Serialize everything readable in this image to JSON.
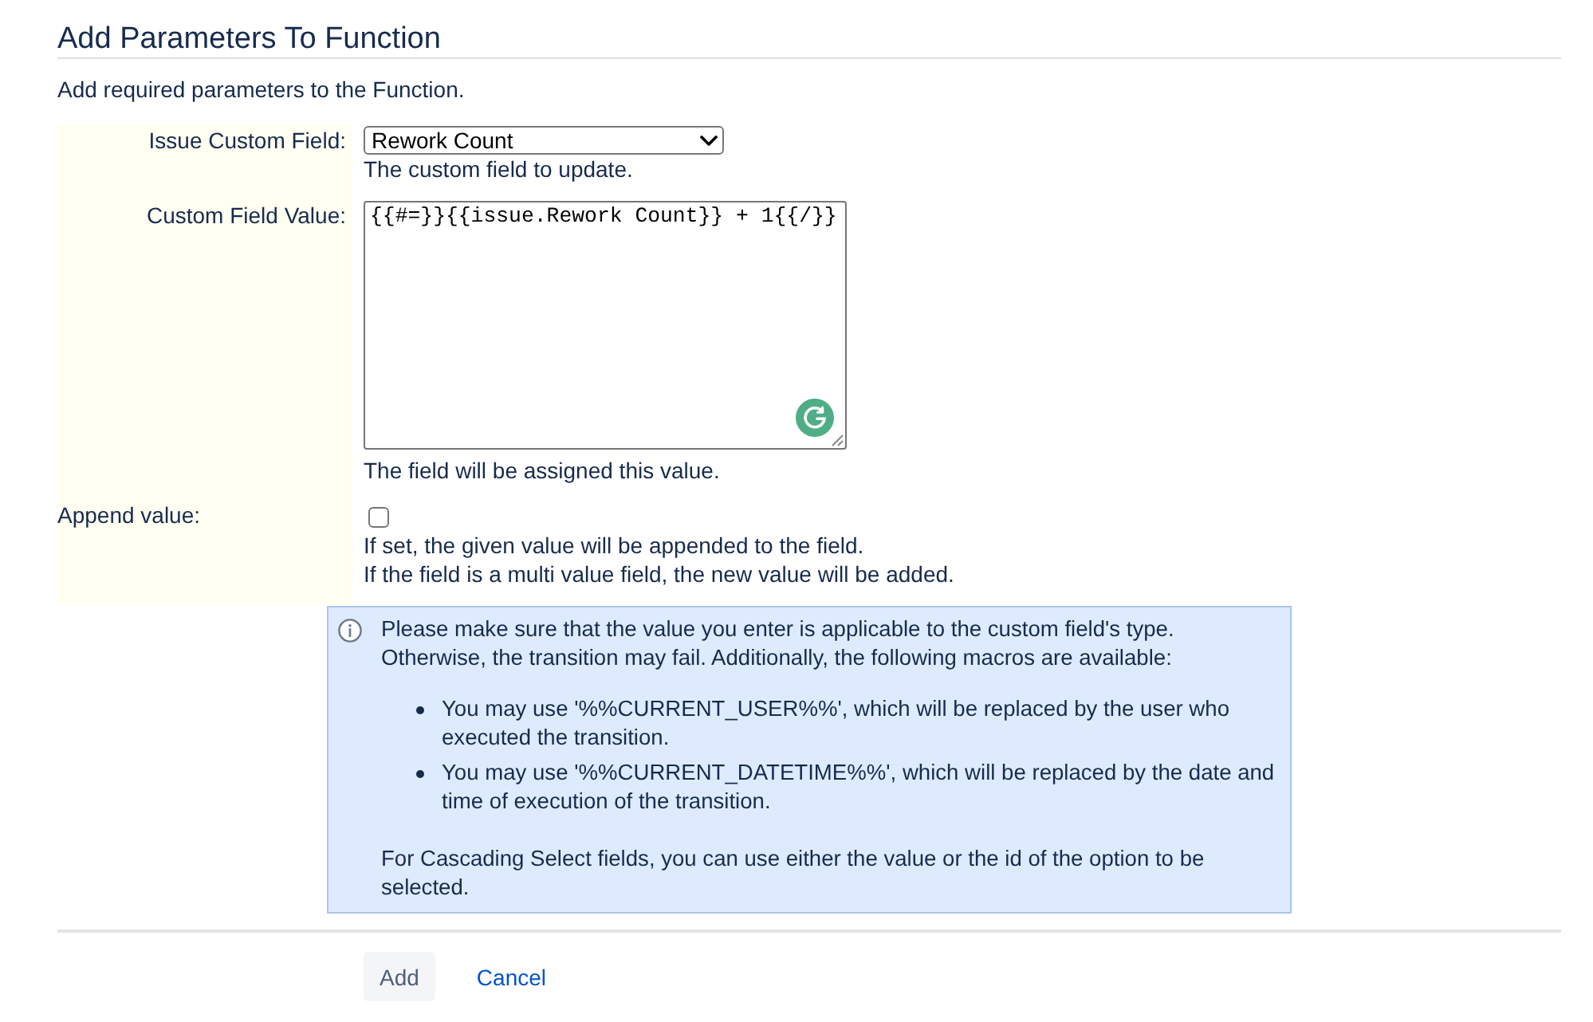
{
  "title": "Add Parameters To Function",
  "description": "Add required parameters to the Function.",
  "fields": [
    {
      "kind": "select",
      "label": "Issue Custom Field:",
      "value": "Rework Count",
      "help": [
        "The custom field to update."
      ]
    },
    {
      "kind": "textarea",
      "label": "Custom Field Value:",
      "value": "{{#=}}{{issue.Rework Count}} + 1{{/}}",
      "help": [
        "The field will be assigned this value."
      ]
    },
    {
      "kind": "checkbox",
      "label": "Append value:",
      "checked": false,
      "help": [
        "If set, the given value will be appended to the field.",
        "If the field is a multi value field, the new value will be added."
      ]
    }
  ],
  "info": {
    "text": "Please make sure that the value you enter is applicable to the custom field's type. Otherwise, the transition may fail. Additionally, the following macros are available:",
    "bullets": [
      "You may use '%%CURRENT_USER%%', which will be replaced by the user who executed the transition.",
      "You may use '%%CURRENT_DATETIME%%', which will be replaced by the date and time of execution of the transition."
    ],
    "footer": "For Cascading Select fields, you can use either the value or the id of the option to be selected."
  },
  "buttons": [
    {
      "kind": "primary",
      "label": "Add"
    },
    {
      "kind": "link",
      "label": "Cancel"
    }
  ]
}
